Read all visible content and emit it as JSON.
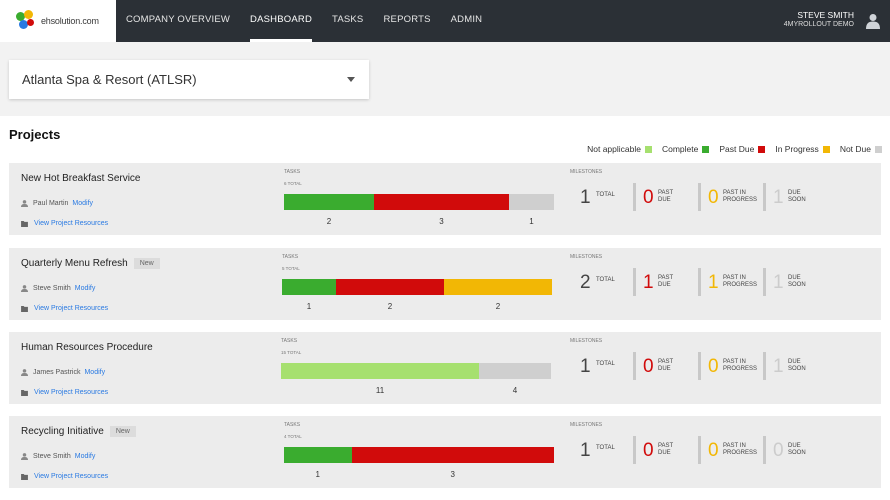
{
  "brand": {
    "logo_text": "ehsolution.com"
  },
  "nav": {
    "items": [
      {
        "label": "COMPANY OVERVIEW",
        "active": false
      },
      {
        "label": "DASHBOARD",
        "active": true
      },
      {
        "label": "TASKS",
        "active": false
      },
      {
        "label": "REPORTS",
        "active": false
      },
      {
        "label": "ADMIN",
        "active": false
      }
    ]
  },
  "user": {
    "name": "STEVE SMITH",
    "account": "4MYROLLOUT DEMO",
    "icon": "user-icon"
  },
  "org_selector": {
    "value": "Atlanta Spa & Resort (ATLSR)"
  },
  "section_title": "Projects",
  "colors": {
    "not_applicable": "#a6e06f",
    "complete": "#3aac2f",
    "past_due": "#d10b0b",
    "in_progress": "#f2b705",
    "not_due": "#cfcfcf"
  },
  "legend": [
    {
      "label": "Not applicable",
      "key": "not_applicable"
    },
    {
      "label": "Complete",
      "key": "complete"
    },
    {
      "label": "Past Due",
      "key": "past_due"
    },
    {
      "label": "In Progress",
      "key": "in_progress"
    },
    {
      "label": "Not Due",
      "key": "not_due"
    }
  ],
  "labels": {
    "tasks": "TASKS",
    "milestones": "MILESTONES",
    "total": "TOTAL",
    "past_due": [
      "PAST",
      "DUE"
    ],
    "past_in_progress": [
      "PAST IN",
      "PROGRESS"
    ],
    "due_soon": [
      "DUE",
      "SOON"
    ],
    "modify": "Modify",
    "view_resources": "View Project Resources",
    "new_badge": "New"
  },
  "projects": [
    {
      "name": "New Hot Breakfast Service",
      "is_new": false,
      "owner": "Paul Martin",
      "tasks_total_label": "6 TOTAL",
      "segments": [
        {
          "status": "complete",
          "count": 2
        },
        {
          "status": "past_due",
          "count": 3
        },
        {
          "status": "not_due",
          "count": 1
        }
      ],
      "milestones": {
        "total": 1,
        "past_due": 0,
        "past_in_progress": 0,
        "due_soon": 1
      }
    },
    {
      "name": "Quarterly Menu Refresh",
      "is_new": true,
      "owner": "Steve Smith",
      "tasks_total_label": "5 TOTAL",
      "segments": [
        {
          "status": "complete",
          "count": 1
        },
        {
          "status": "past_due",
          "count": 2
        },
        {
          "status": "in_progress",
          "count": 2
        }
      ],
      "milestones": {
        "total": 2,
        "past_due": 1,
        "past_in_progress": 1,
        "due_soon": 1
      }
    },
    {
      "name": "Human Resources Procedure",
      "is_new": false,
      "owner": "James Pastrick",
      "tasks_total_label": "15 TOTAL",
      "segments": [
        {
          "status": "not_applicable",
          "count": 11
        },
        {
          "status": "not_due",
          "count": 4
        }
      ],
      "milestones": {
        "total": 1,
        "past_due": 0,
        "past_in_progress": 0,
        "due_soon": 1
      }
    },
    {
      "name": "Recycling Initiative",
      "is_new": true,
      "owner": "Steve Smith",
      "tasks_total_label": "4 TOTAL",
      "segments": [
        {
          "status": "complete",
          "count": 1
        },
        {
          "status": "past_due",
          "count": 3
        }
      ],
      "milestones": {
        "total": 1,
        "past_due": 0,
        "past_in_progress": 0,
        "due_soon": 0
      }
    }
  ]
}
